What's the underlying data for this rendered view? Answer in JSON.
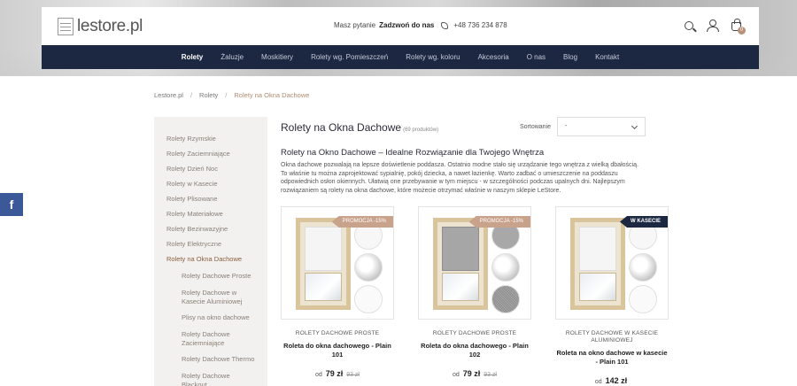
{
  "header": {
    "logo_text": "lestore.pl",
    "contact_prompt": "Masz pytanie",
    "contact_action": "Zadzwoń do nas",
    "phone": "+48 736 234 878",
    "cart_count": "0"
  },
  "nav": {
    "items": [
      "Rolety",
      "Żaluzje",
      "Moskitiery",
      "Rolety wg. Pomieszczeń",
      "Rolety wg. koloru",
      "Akcesoria",
      "O nas",
      "Blog",
      "Kontakt"
    ]
  },
  "breadcrumb": [
    "Lestore.pl",
    "Rolety",
    "Rolety na Okna Dachowe"
  ],
  "facebook_label": "f",
  "sidebar": {
    "categories": [
      "Rolety Rzymskie",
      "Rolety Zaciemniające",
      "Rolety Dzień Noc",
      "Rolety w Kasecie",
      "Rolety Plisowane",
      "Rolety Materiałowe",
      "Rolety Bezinwazyjne",
      "Rolety Elektryczne",
      "Rolety na Okna Dachowe"
    ],
    "subcategories": [
      "Rolety Dachowe Proste",
      "Rolety Dachowe w Kasecie Aluminiowej",
      "Plisy na okno dachowe",
      "Rolety Dachowe Zaciemniające",
      "Rolety Dachowe Thermo",
      "Rolety Dachowe Blackout"
    ]
  },
  "main": {
    "title": "Rolety na Okna Dachowe",
    "count": "(69 produktów)",
    "sort_label": "Sortowanie",
    "sort_value": "-",
    "subtitle": "Rolety na Okno Dachowe – Idealne Rozwiązanie dla Twojego Wnętrza",
    "description": "Okna dachowe pozwalają na lepsze doświetlenie poddasza. Ostatnio modne stało się urządzanie tego wnętrza z wielką dbałością. To właśnie tu można zaprojektować sypialnię, pokój dziecka, a nawet łazienkę. Warto zadbać o umieszczenie na poddaszu odpowiednich osłon okiennych. Ułatwią one przebywanie w tym miejscu - w szczególności podczas upalnych dni. Najlepszym rozwiązaniem są rolety na okna dachowe, które możecie otrzymać właśnie w naszym sklepie LeStore."
  },
  "products": [
    {
      "badge": "PROMOCJA -15%",
      "category": "ROLETY DACHOWE PROSTE",
      "name": "Roleta do okna dachowego - Plain 101",
      "price_prefix": "od",
      "price": "79 zł",
      "old_price": "93 zł"
    },
    {
      "badge": "PROMOCJA -15%",
      "category": "ROLETY DACHOWE PROSTE",
      "name": "Roleta do okna dachowego - Plain 102",
      "price_prefix": "od",
      "price": "79 zł",
      "old_price": "93 zł"
    },
    {
      "badge": "W KASECIE",
      "category": "ROLETY DACHOWE W KASECIE ALUMINIOWEJ",
      "name": "Roleta na okno dachowe w kasecie - Plain 101",
      "price_prefix": "od",
      "price": "142 zł",
      "old_price": ""
    }
  ]
}
